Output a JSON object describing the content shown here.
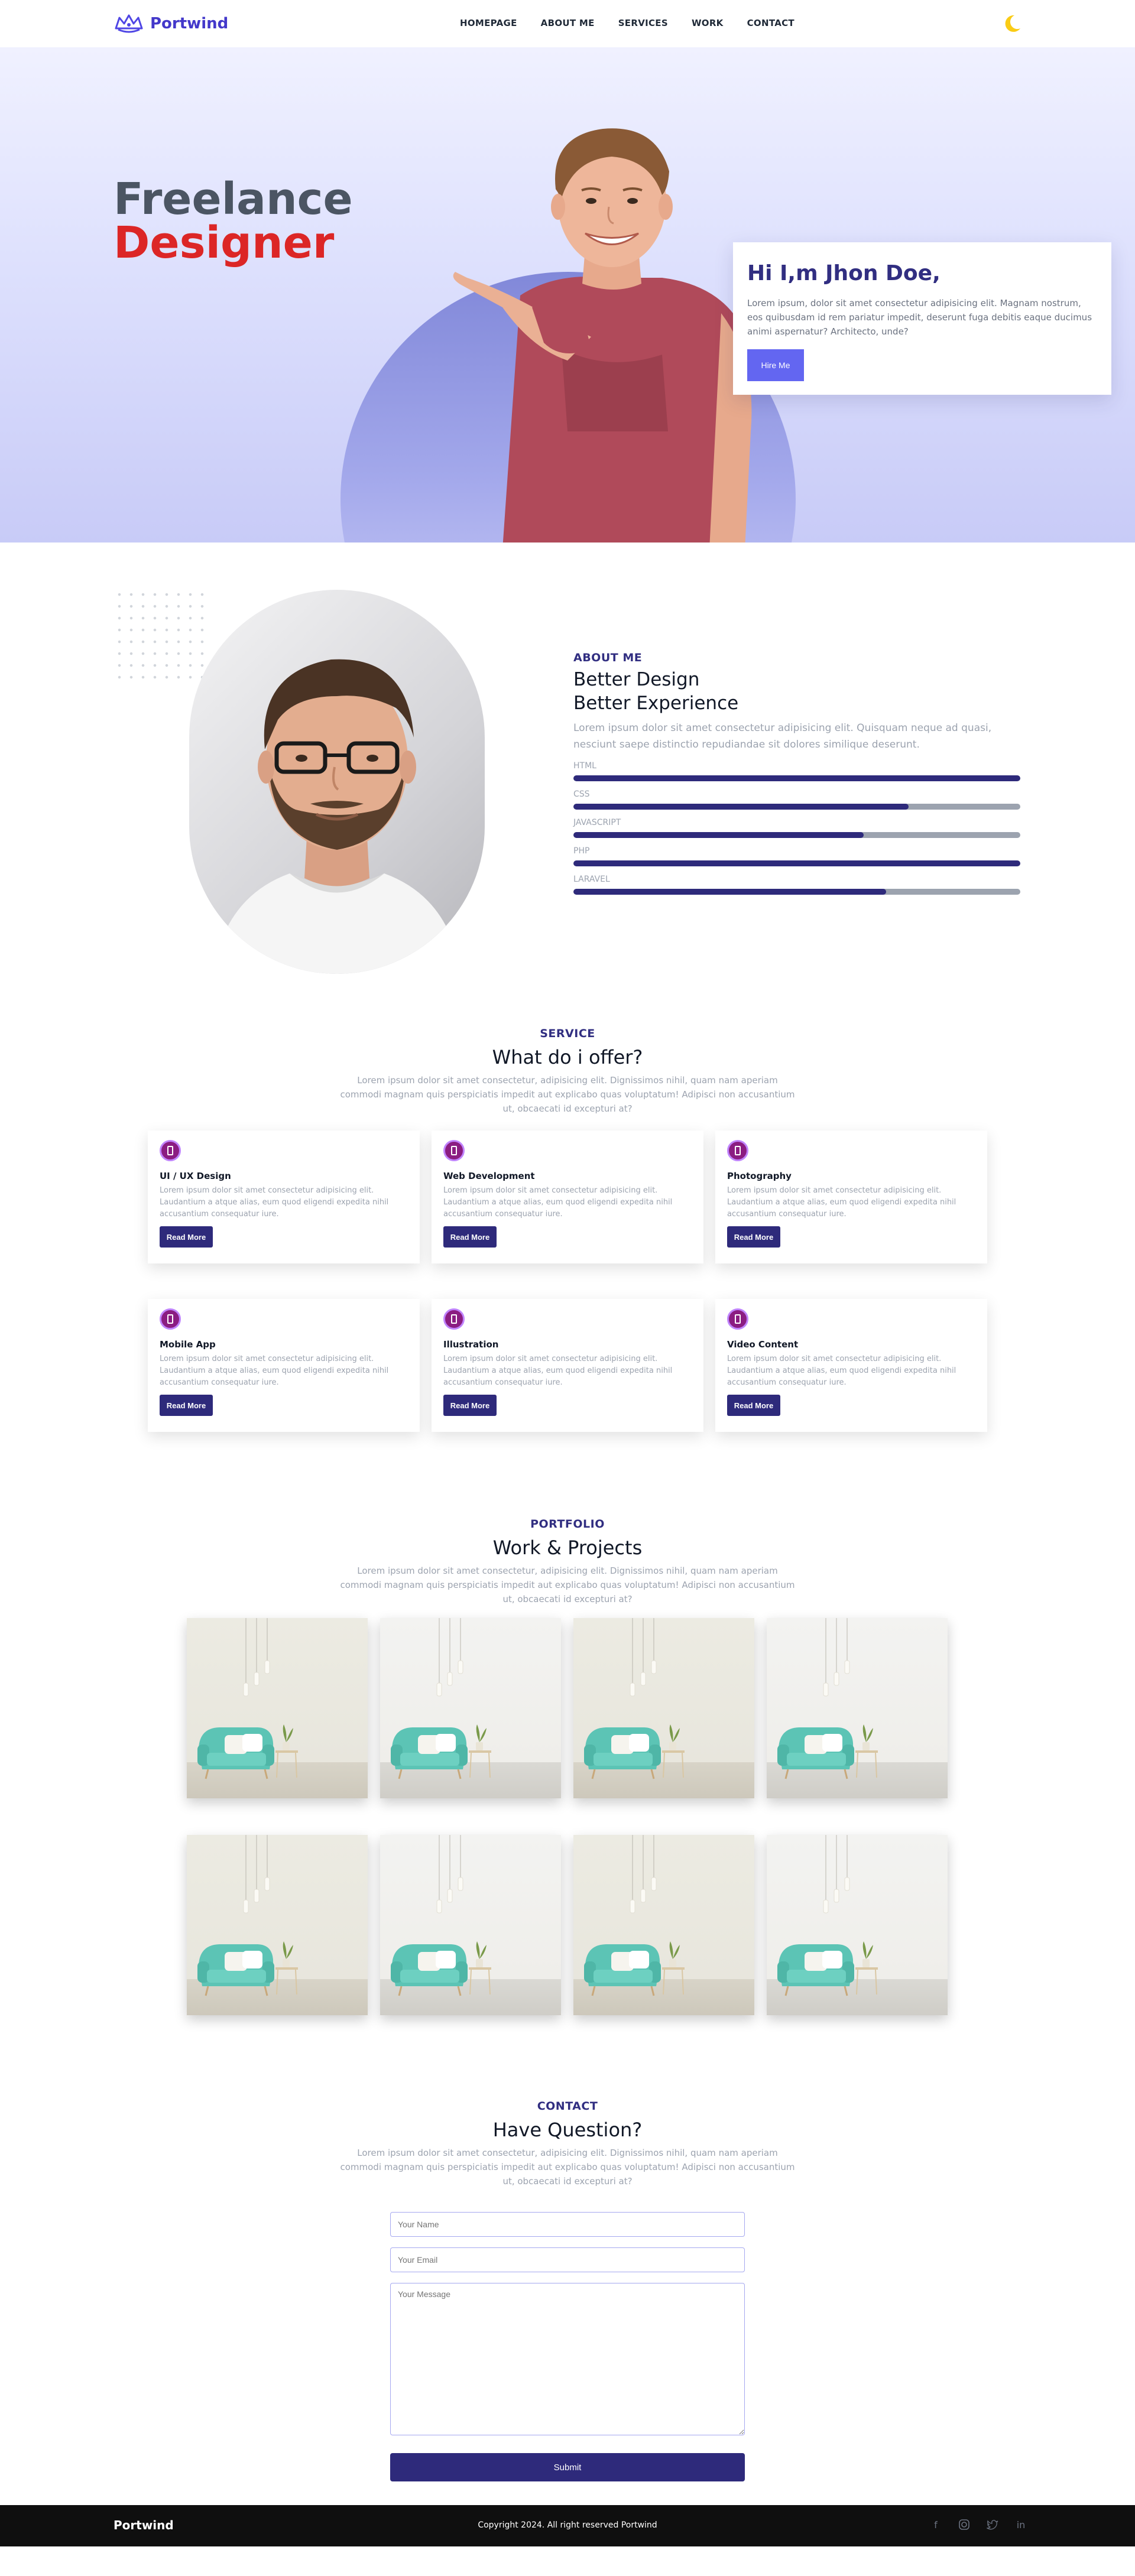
{
  "brand": {
    "name": "Portwind"
  },
  "nav": {
    "items": [
      {
        "label": "HOMEPAGE"
      },
      {
        "label": "ABOUT ME"
      },
      {
        "label": "SERVICES"
      },
      {
        "label": "WORK"
      },
      {
        "label": "CONTACT"
      }
    ],
    "theme_icon": "moon-icon"
  },
  "hero": {
    "title_line1": "Freelance",
    "title_line2": "Designer",
    "greeting": "Hi I,m Jhon Doe,",
    "intro": "Lorem ipsum, dolor sit amet consectetur adipisicing elit. Magnam nostrum, eos quibusdam id rem pariatur impedit, deserunt fuga debitis eaque ducimus animi aspernatur? Architecto, unde?",
    "cta_label": "Hire Me"
  },
  "about": {
    "eyebrow": "ABOUT ME",
    "heading_line1": "Better Design",
    "heading_line2": "Better Experience",
    "description": "Lorem ipsum dolor sit amet consectetur adipisicing elit. Quisquam neque ad quasi, nesciunt saepe distinctio repudiandae sit dolores similique deserunt.",
    "skills": [
      {
        "name": "HTML",
        "level": 1.0
      },
      {
        "name": "CSS",
        "level": 0.75
      },
      {
        "name": "JAVASCRIPT",
        "level": 0.65
      },
      {
        "name": "PHP",
        "level": 1.0
      },
      {
        "name": "LARAVEL",
        "level": 0.7
      }
    ]
  },
  "services": {
    "eyebrow": "SERVICE",
    "heading": "What do i offer?",
    "description": "Lorem ipsum dolor sit amet consectetur, adipisicing elit. Dignissimos nihil, quam nam aperiam commodi magnam quis perspiciatis impedit aut explicabo quas voluptatum! Adipisci non accusantium ut, obcaecati id excepturi at?",
    "read_more_label": "Read More",
    "items": [
      {
        "title": "UI / UX Design",
        "text": "Lorem ipsum dolor sit amet consectetur adipisicing elit. Laudantium a atque alias, eum quod eligendi expedita nihil accusantium consequatur iure."
      },
      {
        "title": "Web Development",
        "text": "Lorem ipsum dolor sit amet consectetur adipisicing elit. Laudantium a atque alias, eum quod eligendi expedita nihil accusantium consequatur iure."
      },
      {
        "title": "Photography",
        "text": "Lorem ipsum dolor sit amet consectetur adipisicing elit. Laudantium a atque alias, eum quod eligendi expedita nihil accusantium consequatur iure."
      },
      {
        "title": "Mobile App",
        "text": "Lorem ipsum dolor sit amet consectetur adipisicing elit. Laudantium a atque alias, eum quod eligendi expedita nihil accusantium consequatur iure."
      },
      {
        "title": "Illustration",
        "text": "Lorem ipsum dolor sit amet consectetur adipisicing elit. Laudantium a atque alias, eum quod eligendi expedita nihil accusantium consequatur iure."
      },
      {
        "title": "Video Content",
        "text": "Lorem ipsum dolor sit amet consectetur adipisicing elit. Laudantium a atque alias, eum quod eligendi expedita nihil accusantium consequatur iure."
      }
    ]
  },
  "portfolio": {
    "eyebrow": "PORTFOLIO",
    "heading": "Work & Projects",
    "description": "Lorem ipsum dolor sit amet consectetur, adipisicing elit. Dignissimos nihil, quam nam aperiam commodi magnam quis perspiciatis impedit aut explicabo quas voluptatum! Adipisci non accusantium ut, obcaecati id excepturi at?"
  },
  "contact": {
    "eyebrow": "CONTACT",
    "heading": "Have Question?",
    "description": "Lorem ipsum dolor sit amet consectetur, adipisicing elit. Dignissimos nihil, quam nam aperiam commodi magnam quis perspiciatis impedit aut explicabo quas voluptatum! Adipisci non accusantium ut, obcaecati id excepturi at?",
    "name_placeholder": "Your Name",
    "email_placeholder": "Your Email",
    "message_placeholder": "Your Message",
    "submit_label": "Submit"
  },
  "footer": {
    "brand": "Portwind",
    "copyright": "Copyright 2024. All right reserved Portwind",
    "social_icons": [
      "facebook-icon",
      "instagram-icon",
      "twitter-icon",
      "linkedin-icon"
    ]
  },
  "colors": {
    "primary": "#2e2a7b",
    "accent": "#6366f1",
    "highlight": "#dc2626",
    "service_icon": "#8b1d82"
  }
}
